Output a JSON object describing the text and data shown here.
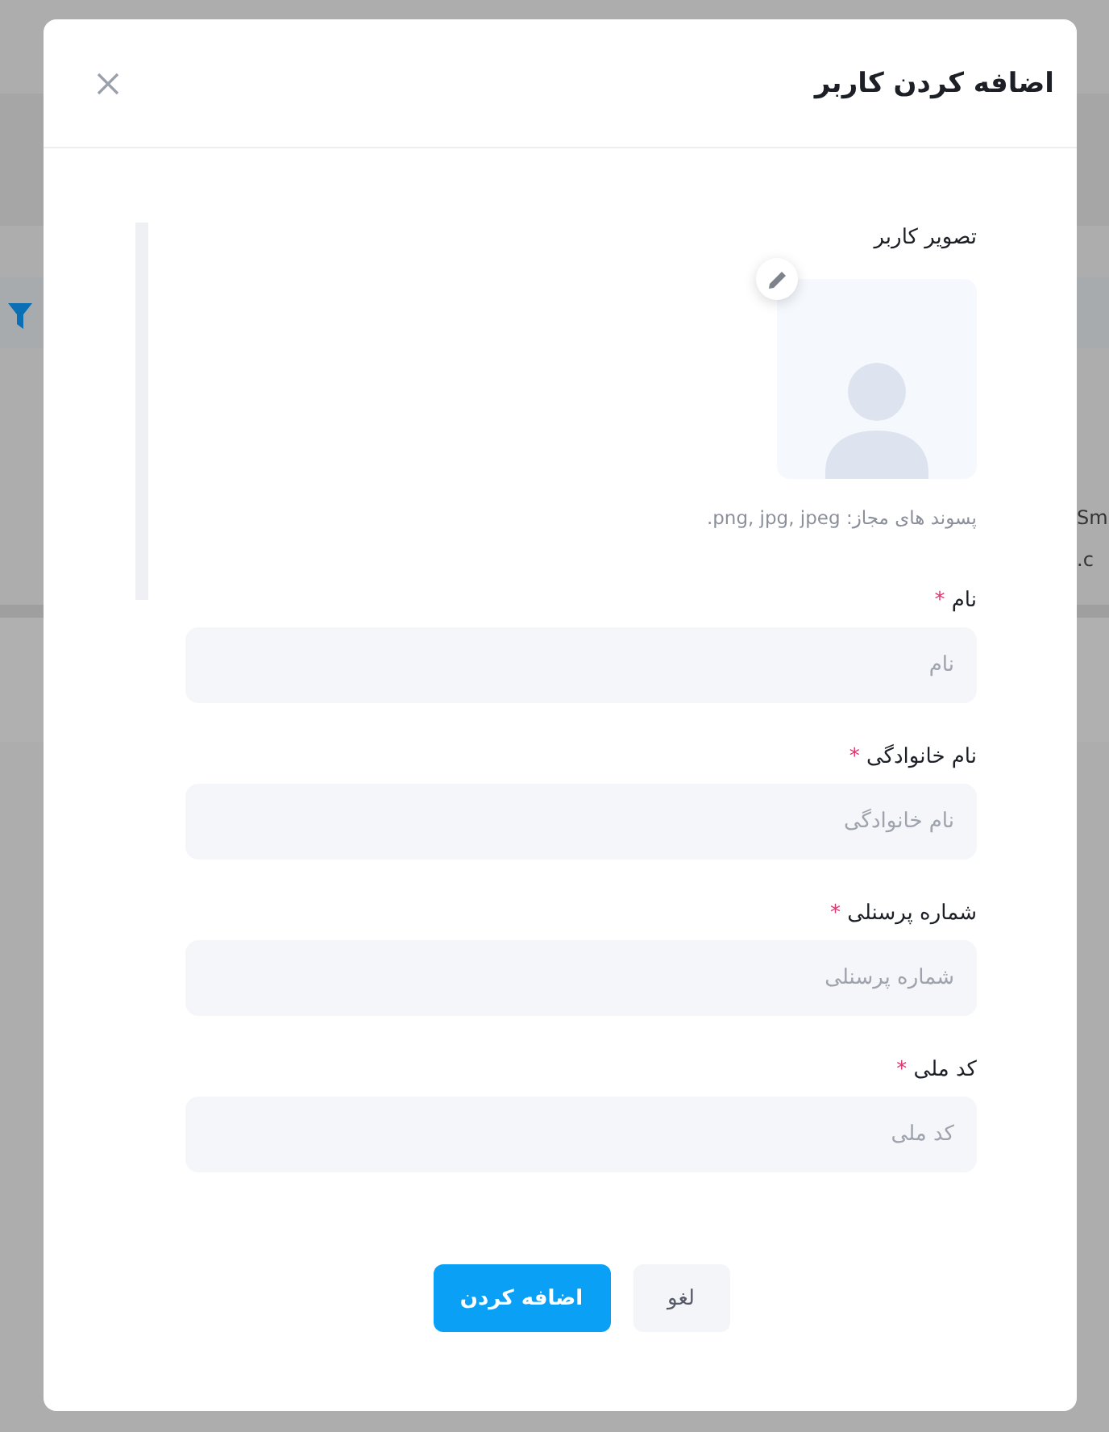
{
  "background": {
    "texts": [
      "Sm",
      ".c"
    ]
  },
  "dialog": {
    "title": "اضافه کردن کاربر",
    "avatar": {
      "label": "تصویر کاربر",
      "hint": "پسوند های مجاز: png, jpg, jpeg."
    },
    "fields": [
      {
        "label": "نام",
        "required_mark": "*",
        "placeholder": "نام"
      },
      {
        "label": "نام خانوادگی",
        "required_mark": "*",
        "placeholder": "نام خانوادگی"
      },
      {
        "label": "شماره پرسنلی",
        "required_mark": "*",
        "placeholder": "شماره پرسنلی"
      },
      {
        "label": "کد ملی",
        "required_mark": "*",
        "placeholder": "کد ملی"
      }
    ],
    "buttons": [
      {
        "label": "لغو",
        "kind": "secondary"
      },
      {
        "label": "اضافه کردن",
        "kind": "primary"
      }
    ]
  }
}
